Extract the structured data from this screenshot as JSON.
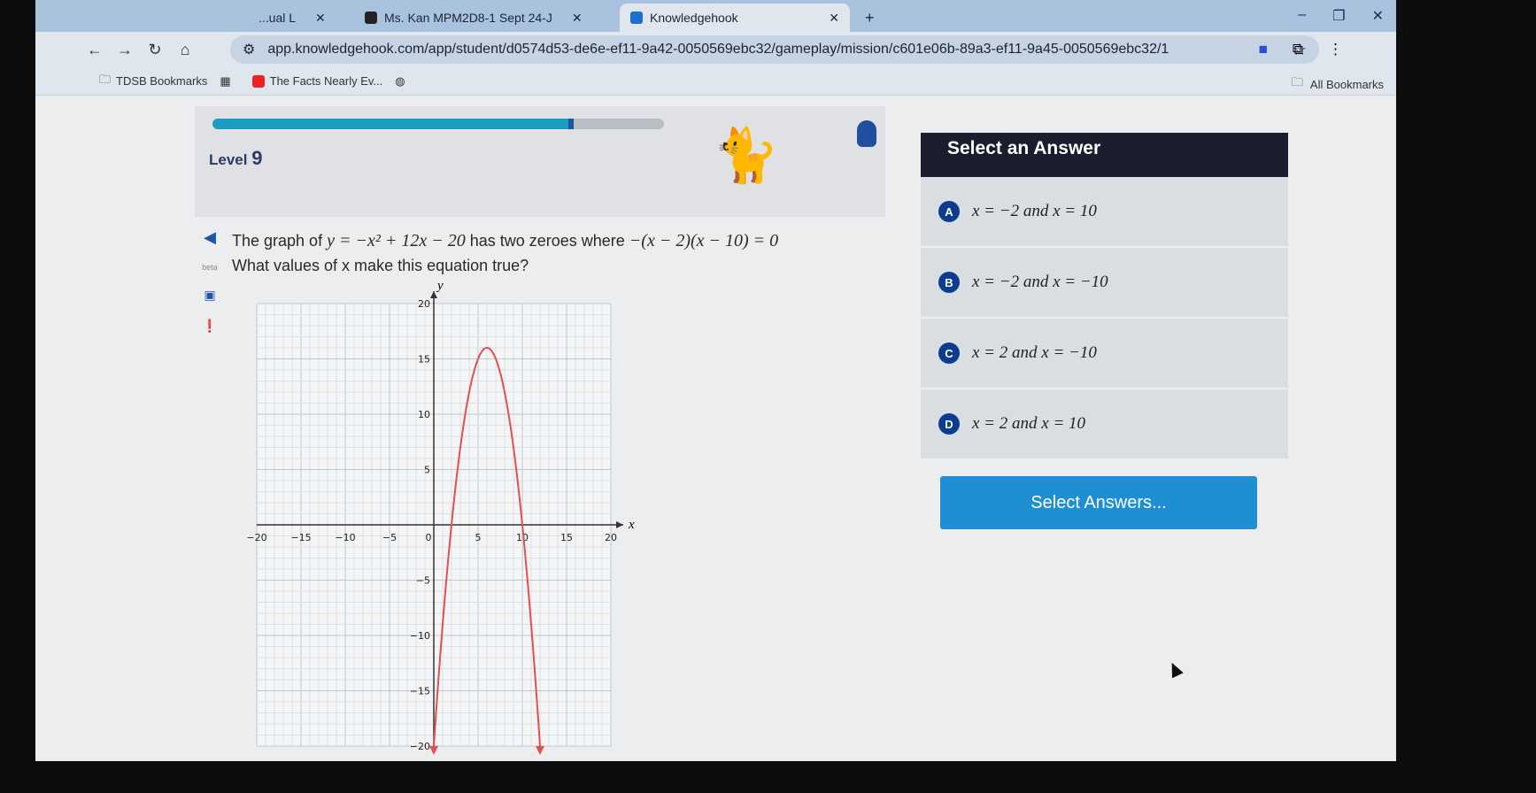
{
  "browser": {
    "tabs": [
      {
        "label": "...ual L"
      },
      {
        "label": "Ms. Kan MPM2D8-1 Sept 24-J"
      },
      {
        "label": "Knowledgehook",
        "active": true
      }
    ],
    "url": "app.knowledgehook.com/app/student/d0574d53-de6e-ef11-9a42-0050569ebc32/gameplay/mission/c601e06b-89a3-ef11-9a45-0050569ebc32/1",
    "bookmarks": [
      {
        "label": "TDSB Bookmarks"
      },
      {
        "label": "The Facts Nearly Ev..."
      }
    ],
    "all_bookmarks": "All Bookmarks"
  },
  "header": {
    "progress_percent": 80,
    "level_label": "Level",
    "level_value": "9",
    "accent": "#1e9bc0"
  },
  "question": {
    "line1_a": "The graph of ",
    "line1_eq": "y = −x² + 12x − 20",
    "line1_b": " has two zeroes where ",
    "line1_eq2": "−(x − 2)(x − 10) = 0",
    "line2": "What values of x make this equation true?",
    "beta": "beta"
  },
  "chart_data": {
    "type": "line",
    "function": "y = -x^2 + 12x - 20",
    "xlabel": "x",
    "ylabel": "y",
    "xlim": [
      -20,
      20
    ],
    "ylim": [
      -20,
      20
    ],
    "grid": true,
    "x_ticks": [
      -20,
      -15,
      -10,
      -5,
      0,
      5,
      10,
      15,
      20
    ],
    "y_ticks": [
      20,
      15,
      10,
      5,
      -5,
      -10,
      -15,
      -20
    ],
    "line_color": "#e05050"
  },
  "answers": {
    "title": "Select an Answer",
    "options": [
      {
        "letter": "A",
        "text": "x = −2 and x = 10"
      },
      {
        "letter": "B",
        "text": "x = −2 and x = −10"
      },
      {
        "letter": "C",
        "text": "x = 2 and x = −10"
      },
      {
        "letter": "D",
        "text": "x = 2 and x = 10"
      }
    ],
    "submit": "Select Answers..."
  }
}
